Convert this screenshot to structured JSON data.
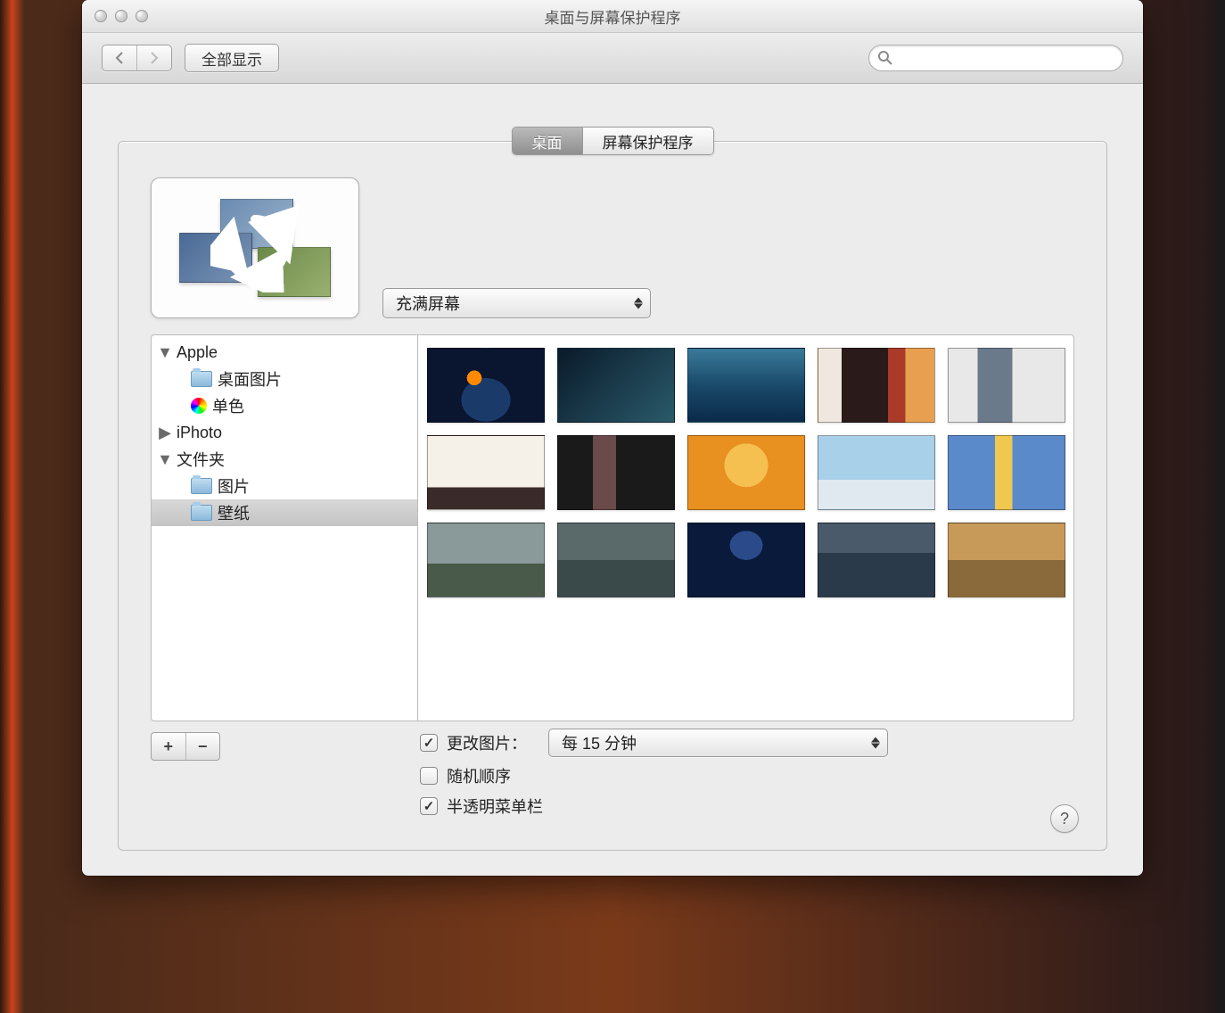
{
  "window": {
    "title": "桌面与屏幕保护程序"
  },
  "toolbar": {
    "show_all_label": "全部显示",
    "search_placeholder": ""
  },
  "tabs": {
    "desktop": "桌面",
    "screensaver": "屏幕保护程序"
  },
  "fill_dropdown": {
    "selected": "充满屏幕"
  },
  "sidebar": {
    "apple": {
      "label": "Apple",
      "expanded": true
    },
    "apple_children": {
      "desktop_pictures": "桌面图片",
      "solid_colors": "单色"
    },
    "iphoto": {
      "label": "iPhoto",
      "expanded": false
    },
    "folders": {
      "label": "文件夹",
      "expanded": true
    },
    "folders_children": {
      "pictures": "图片",
      "wallpapers": "壁纸"
    }
  },
  "options": {
    "change_picture_label": "更改图片：",
    "change_interval_selected": "每 15 分钟",
    "random_order_label": "随机顺序",
    "translucent_menubar_label": "半透明菜单栏",
    "change_picture_checked": true,
    "random_order_checked": false,
    "translucent_menubar_checked": true
  },
  "help": {
    "label": "?"
  },
  "icons": {
    "plus": "+",
    "minus": "−"
  }
}
